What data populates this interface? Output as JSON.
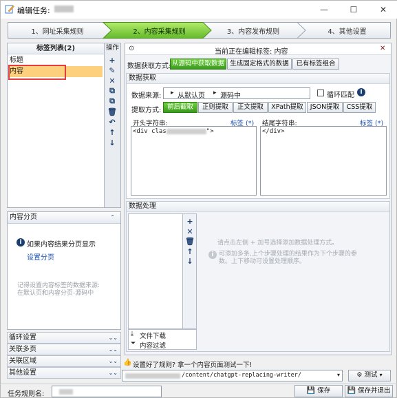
{
  "window": {
    "title": "编辑任务:",
    "controls": {
      "minimize": "—",
      "maximize": "☐",
      "close": "✕"
    }
  },
  "steps": [
    {
      "label": "1、网址采集规则",
      "active": false
    },
    {
      "label": "2、内容采集规则",
      "active": true
    },
    {
      "label": "3、内容发布规则",
      "active": false
    },
    {
      "label": "4、其他设置",
      "active": false
    }
  ],
  "tag_list": {
    "header": "标签列表(2)",
    "ops_header": "操作",
    "items": [
      "标题",
      "内容"
    ],
    "selected_index": 1,
    "tools": [
      "+",
      "✎",
      "✕",
      "⧉",
      "⧉",
      "🗑",
      "↶",
      "↑",
      "↓"
    ]
  },
  "pagination": {
    "title": "内容分页",
    "info": "如果内容结果分页显示",
    "link": "设置分页",
    "note_line1": "记得设置内容标签的数据来源:",
    "note_line2": "在默认页和内容分页-源码中"
  },
  "collapsed_sections": [
    "循环设置",
    "关联多页",
    "关联区域",
    "其他设置"
  ],
  "editor": {
    "banner": "当前正在编辑标签: 内容",
    "acquire_label": "数据获取方式:",
    "acquire_modes": [
      "从源码中获取数据",
      "生成固定格式的数据",
      "已有标签组合"
    ],
    "acquire_active": 0,
    "data_fetch_title": "数据获取",
    "source_label": "数据来源:",
    "source_path": [
      "从默认页",
      "源码中"
    ],
    "loop_match": "循环匹配",
    "method_label": "提取方式:",
    "methods": [
      "前后截取",
      "正则提取",
      "正文提取",
      "XPath提取",
      "JSON提取",
      "CSS提取"
    ],
    "method_active": 0,
    "start_label": "开头字符串:",
    "end_label": "结尾字符串:",
    "tag_link": "标签 (*)",
    "start_value": "<div clas",
    "start_value_end": "\">",
    "end_value": "</div>",
    "processing_title": "数据处理",
    "process_tools": [
      "+",
      "✕",
      "🗑",
      "↑",
      "↓"
    ],
    "process_actions": [
      "文件下载",
      "内容过滤"
    ],
    "hint1": "请点击左侧 + 加号选择添加数据处理方式。",
    "hint2": "可添加多条,上个步骤处理的结果作为下个步骤的参数。上下移动可设置处理顺序。"
  },
  "test_bar": {
    "prompt": "设置好了规则? 拿一个内容页面测试一下!",
    "url_suffix": "/content/chatgpt-replacing-writer/",
    "test_button": "测试"
  },
  "footer": {
    "rule_name_label": "任务规则名:",
    "save": "保存",
    "save_exit": "保存并退出"
  }
}
